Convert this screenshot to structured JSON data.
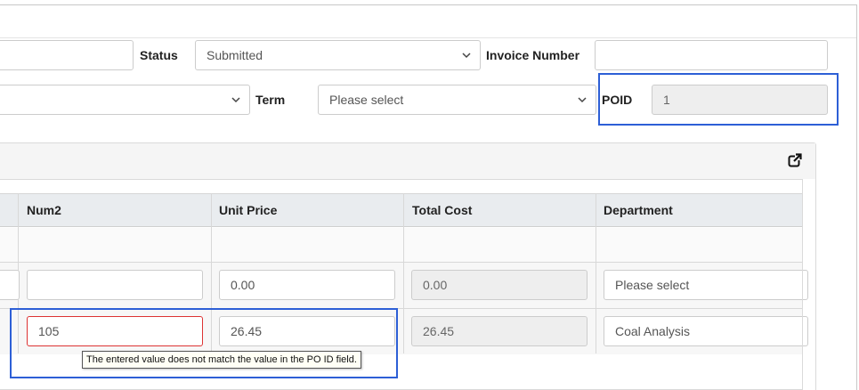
{
  "form": {
    "status_label": "Status",
    "status_value": "Submitted",
    "invoice_number_label": "Invoice Number",
    "invoice_number_value": "",
    "term_label": "Term",
    "term_value": "Please select",
    "poid_label": "POID",
    "poid_value": "1",
    "left_top_value": "",
    "left_select_value": ""
  },
  "panel": {
    "popout_icon": "external-link-icon"
  },
  "grid": {
    "columns": [
      "Num2",
      "Unit Price",
      "Total Cost",
      "Department"
    ],
    "rows": [
      {
        "num2": "",
        "unit_price": "0.00",
        "total_cost": "0.00",
        "department": "Please select"
      },
      {
        "num2": "105",
        "unit_price": "26.45",
        "total_cost": "26.45",
        "department": "Coal Analysis"
      }
    ]
  },
  "validation": {
    "tooltip": "The entered value does not match the value in the PO ID field."
  },
  "colors": {
    "highlight": "#2d5fd6",
    "error_border": "#dd3333",
    "header_bg": "#e9ecef"
  }
}
